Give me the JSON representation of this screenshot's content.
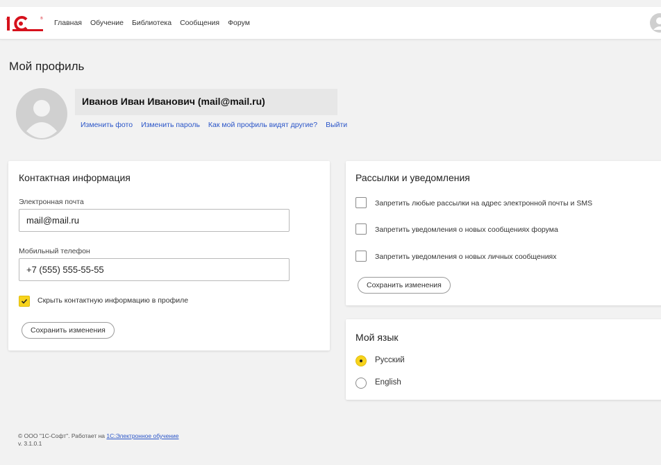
{
  "header": {
    "nav": [
      "Главная",
      "Обучение",
      "Библиотека",
      "Сообщения",
      "Форум"
    ]
  },
  "page": {
    "title": "Мой профиль"
  },
  "profile": {
    "name": "Иванов Иван Иванович (mail@mail.ru)",
    "links": [
      "Изменить фото",
      "Изменить пароль",
      "Как мой профиль видят другие?",
      "Выйти"
    ]
  },
  "contact": {
    "title": "Контактная информация",
    "email_label": "Электронная почта",
    "email_value": "mail@mail.ru",
    "phone_label": "Мобильный телефон",
    "phone_value": "+7 (555) 555-55-55",
    "hide_label": "Скрыть контактную информацию в профиле",
    "hide_checked": true,
    "save_label": "Сохранить изменения"
  },
  "notifications": {
    "title": "Рассылки и уведомления",
    "options": [
      {
        "label": "Запретить любые рассылки на адрес электронной почты и SMS",
        "checked": false
      },
      {
        "label": "Запретить уведомления о новых сообщениях форума",
        "checked": false
      },
      {
        "label": "Запретить уведомления о новых личных сообщениях",
        "checked": false
      }
    ],
    "save_label": "Сохранить изменения"
  },
  "language": {
    "title": "Мой язык",
    "options": [
      {
        "label": "Русский",
        "selected": true
      },
      {
        "label": "English",
        "selected": false
      }
    ]
  },
  "footer": {
    "copyright": "© ООО \"1С-Софт\". Работает на ",
    "link": "1С:Электронное обучение",
    "version": "v. 3.1.0.1"
  },
  "colors": {
    "accent": "#f7d31c",
    "logo_red": "#d6111c",
    "link": "#2a55c8"
  }
}
